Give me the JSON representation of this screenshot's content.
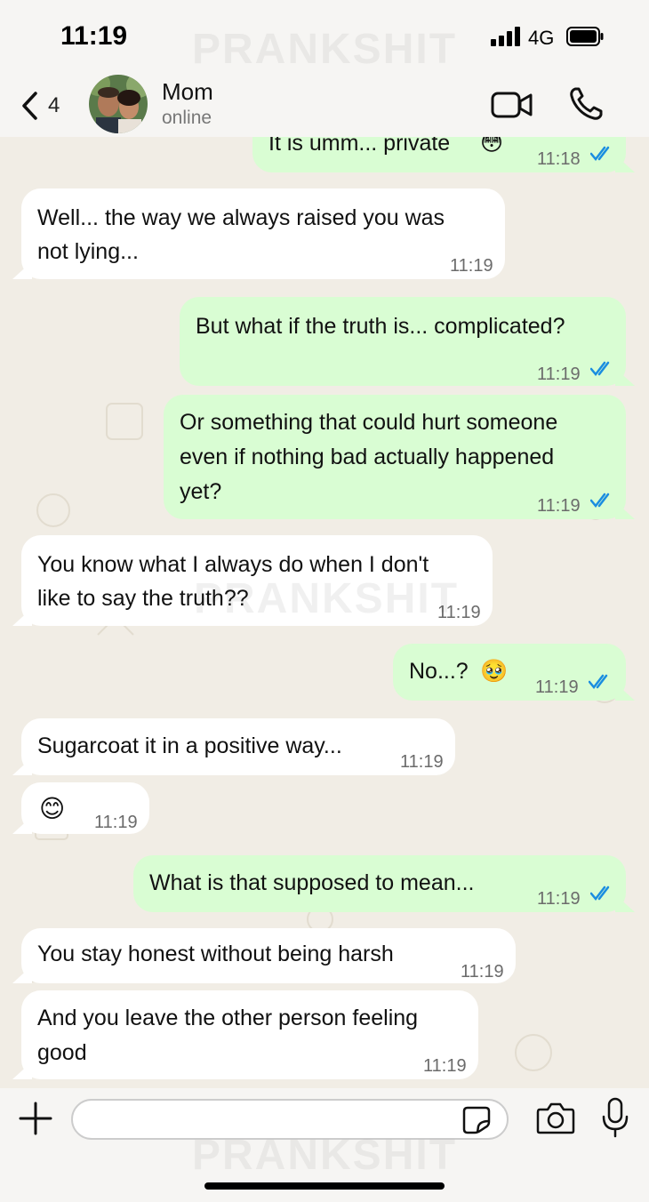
{
  "status_bar": {
    "time": "11:19",
    "network": "4G"
  },
  "watermark": "PRANKSHIT",
  "header": {
    "back_count": "4",
    "contact_name": "Mom",
    "contact_status": "online"
  },
  "messages": [
    {
      "dir": "out",
      "text": "It is umm... private",
      "emoji": "😳",
      "time": "11:18",
      "read": true
    },
    {
      "dir": "in",
      "lines": [
        "Well... the way we always raised you was",
        "not lying..."
      ],
      "time": "11:19"
    },
    {
      "dir": "out",
      "text": "But what if the truth is... complicated?",
      "time": "11:19",
      "read": true
    },
    {
      "dir": "out",
      "lines": [
        "Or something that could hurt someone",
        "even if nothing bad actually happened",
        "yet?"
      ],
      "time": "11:19",
      "read": true
    },
    {
      "dir": "in",
      "lines": [
        "You know what I always do when I don't",
        "like to say the truth??"
      ],
      "time": "11:19"
    },
    {
      "dir": "out",
      "text": "No...?",
      "emoji": "🥹",
      "time": "11:19",
      "read": true
    },
    {
      "dir": "in",
      "text": "Sugarcoat it in a positive way...",
      "time": "11:19"
    },
    {
      "dir": "in",
      "emoji": "😊",
      "time": "11:19"
    },
    {
      "dir": "out",
      "text": "What is that supposed to mean...",
      "time": "11:19",
      "read": true
    },
    {
      "dir": "in",
      "text": "You stay honest without being harsh",
      "time": "11:19"
    },
    {
      "dir": "in",
      "lines": [
        "And you leave the other person feeling",
        "good"
      ],
      "time": "11:19"
    }
  ],
  "colors": {
    "incoming": "#ffffff",
    "outgoing": "#d9fdd3",
    "read_ticks": "#1a8de0",
    "chat_bg": "#f1ede5"
  }
}
